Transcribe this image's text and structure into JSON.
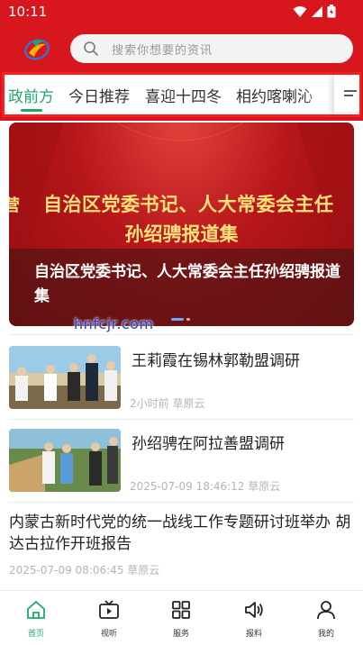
{
  "status_bar": {
    "time": "10:11"
  },
  "colors": {
    "brand_red": "#d8161d",
    "accent_green": "#1fa86a",
    "watermark_blue": "#1a3cd8"
  },
  "search": {
    "placeholder": "搜索你想要的资讯",
    "icon": "search-icon"
  },
  "tabs": [
    {
      "label": "政前方",
      "active": true
    },
    {
      "label": "今日推荐",
      "active": false
    },
    {
      "label": "喜迎十四冬",
      "active": false
    },
    {
      "label": "相约喀喇沁",
      "active": false
    }
  ],
  "banner": {
    "image_line1": "自治区党委书记、人大常委会主任",
    "image_line2": "孙绍骋报道集",
    "image_left_fragment": "营",
    "caption": "自治区党委书记、人大常委会主任孙绍骋报道集",
    "slide_count": 2,
    "active_slide": 1
  },
  "watermark": "hnfcjr.com",
  "news": [
    {
      "title": "王莉霞在锡林郭勒盟调研",
      "time": "2小时前",
      "source": "草原云"
    },
    {
      "title": "孙绍骋在阿拉善盟调研",
      "time": "2025-07-09 18:46:12",
      "source": "草原云"
    }
  ],
  "text_news": {
    "title": "内蒙古新时代党的统一战线工作专题研讨班举办 胡达古拉作开班报告",
    "time": "2025-07-09 08:06:45",
    "source": "草原云"
  },
  "bottom_nav": [
    {
      "label": "首页",
      "icon": "home-icon",
      "active": true
    },
    {
      "label": "视听",
      "icon": "tv-icon",
      "active": false
    },
    {
      "label": "服务",
      "icon": "grid-icon",
      "active": false
    },
    {
      "label": "报料",
      "icon": "speaker-icon",
      "active": false
    },
    {
      "label": "我的",
      "icon": "user-icon",
      "active": false
    }
  ]
}
